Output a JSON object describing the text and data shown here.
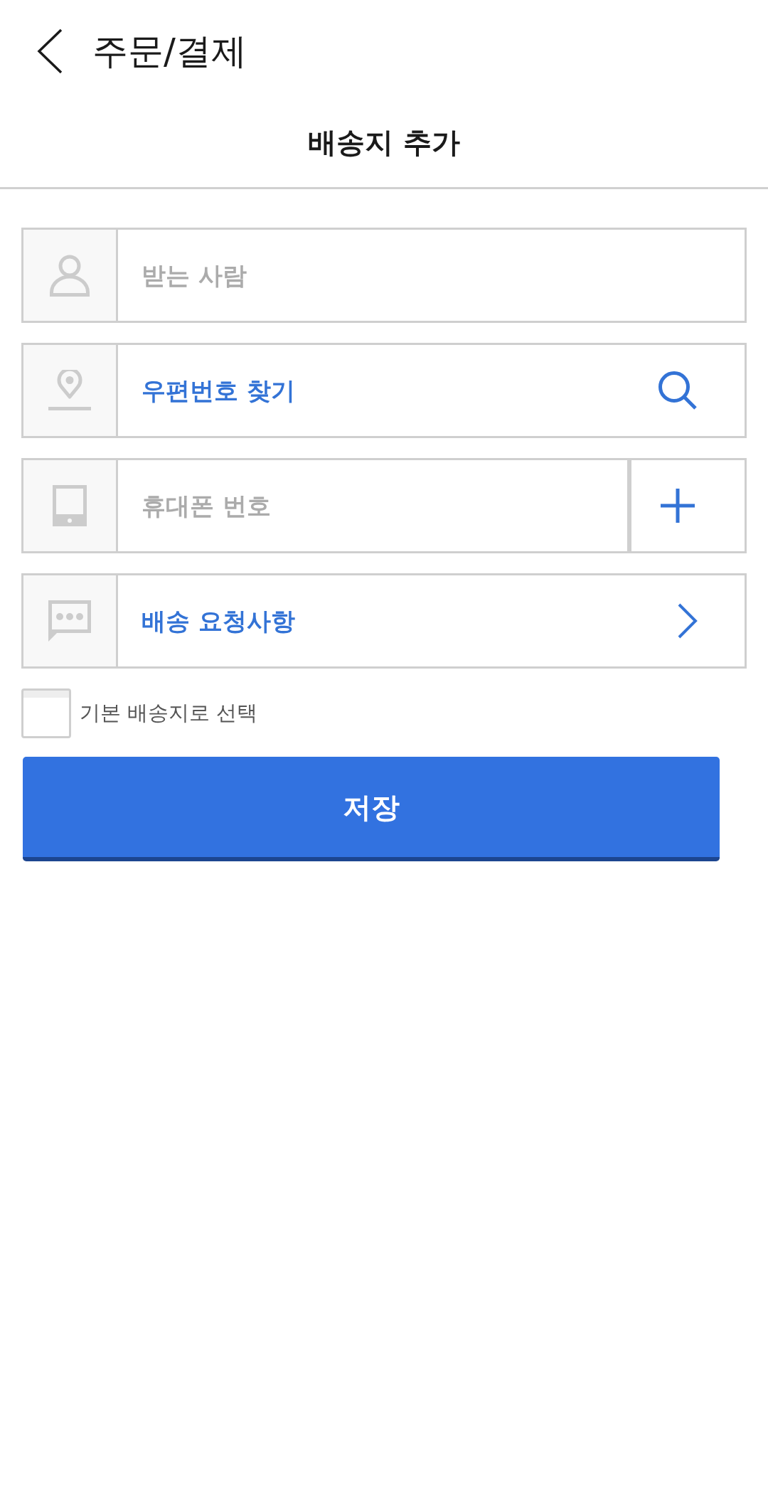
{
  "header": {
    "title": "주문/결제"
  },
  "section": {
    "title": "배송지 추가"
  },
  "fields": [
    {
      "kind": "input",
      "placeholder": "받는 사람"
    },
    {
      "kind": "search",
      "label": "우편번호 찾기"
    },
    {
      "kind": "phone",
      "placeholder": "휴대폰 번호"
    },
    {
      "kind": "link",
      "label": "배송 요청사항"
    }
  ],
  "default_address": {
    "label": "기본 배송지로 선택",
    "checked": false
  },
  "save_button": {
    "label": "저장"
  }
}
